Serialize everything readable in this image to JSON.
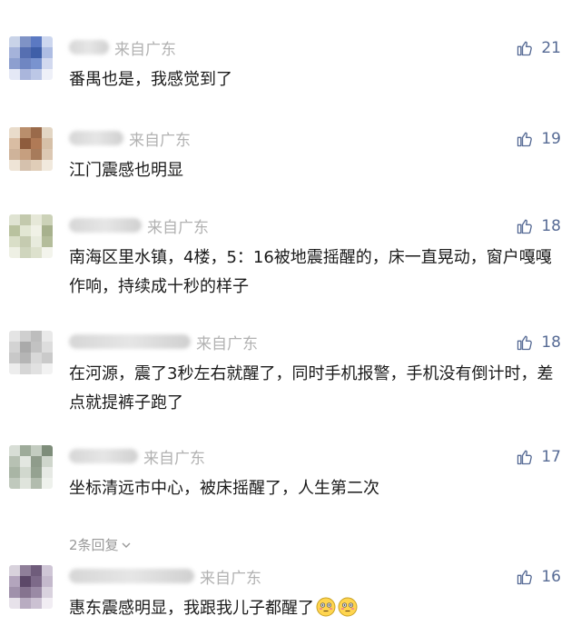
{
  "comments": [
    {
      "source": "来自广东",
      "likes": "21",
      "text": "番禺也是，我感觉到了",
      "avatar_colors": [
        "#c9d3e8",
        "#7f93c6",
        "#5b79c2",
        "#cdd7ef",
        "#a5b3da",
        "#566fb1",
        "#3f5fa8",
        "#aebde3",
        "#8d9fcf",
        "#6f86c2",
        "#7993cf",
        "#d2d9ef",
        "#e4e8f5",
        "#aab6dc",
        "#bcc7e6",
        "#eef0f8"
      ]
    },
    {
      "source": "来自广东",
      "likes": "19",
      "text": "江门震感也明显",
      "avatar_colors": [
        "#e9dccb",
        "#b98e6c",
        "#9a6a4a",
        "#e3d6c4",
        "#d9bda3",
        "#8e5c3d",
        "#b07a56",
        "#d6c0a8",
        "#cfb39a",
        "#c69f7f",
        "#a77b5b",
        "#dcc8b3",
        "#eee4d6",
        "#d5c1ad",
        "#e0cdb8",
        "#f1e9dd"
      ]
    },
    {
      "source": "来自广东",
      "likes": "18",
      "text": "南海区里水镇，4楼，5：16被地震摇醒的，床一直晃动，窗户嘎嘎作响，持续成十秒的样子",
      "avatar_colors": [
        "#dfe3d2",
        "#c3c9ad",
        "#e6e8d8",
        "#ccd2b8",
        "#b9c29f",
        "#e2e6d3",
        "#f0f1e6",
        "#a7b18d",
        "#d9dec7",
        "#c5cbb0",
        "#e8ebdd",
        "#b4bd9b",
        "#eef0e4",
        "#cfd5bd",
        "#dde1cd",
        "#f3f4ec"
      ]
    },
    {
      "source": "来自广东",
      "likes": "18",
      "text": "在河源，震了3秒左右就醒了，同时手机报警，手机没有倒计时，差点就提裤子跑了",
      "avatar_colors": [
        "#e4e4e4",
        "#cfcfcf",
        "#bdbdbd",
        "#e9e9e9",
        "#d3d3d3",
        "#aaaaaa",
        "#c2c2c2",
        "#dddddd",
        "#c8c8c8",
        "#b5b5b5",
        "#d8d8d8",
        "#cacaca",
        "#ededed",
        "#d6d6d6",
        "#e1e1e1",
        "#f2f2f2"
      ]
    },
    {
      "source": "来自广东",
      "likes": "17",
      "text": "坐标清远市中心，被床摇醒了，人生第二次",
      "replies": "2条回复",
      "avatar_colors": [
        "#d8ded6",
        "#9eab9a",
        "#c3ccc0",
        "#7e8d7a",
        "#b7c1b3",
        "#e3e7e1",
        "#8f9c8b",
        "#cfd6cc",
        "#a9b5a5",
        "#d1d8ce",
        "#95a291",
        "#e6e9e4",
        "#c0c9bd",
        "#dfe4dc",
        "#b2bcae",
        "#eef1ec"
      ]
    },
    {
      "source": "来自广东",
      "likes": "16",
      "text": "惠东震感明显，我跟我儿子都醒了",
      "avatar_colors": [
        "#d8d2dc",
        "#8f7f99",
        "#6f5c7b",
        "#cfc6d6",
        "#b3a5bd",
        "#5c4868",
        "#7d6a89",
        "#c4b9cc",
        "#a091ab",
        "#85738f",
        "#9a8aa5",
        "#d9d2de",
        "#e7e2ea",
        "#b8acc1",
        "#cbc1d2",
        "#f1edf3"
      ]
    }
  ],
  "icons": {
    "like": "thumbs-up-icon",
    "chevron": "chevron-down-icon",
    "emoji": "flushed-face-emoji"
  },
  "colors": {
    "link": "#576b95",
    "muted": "#b2b2b2",
    "text": "#1a1a1a"
  }
}
